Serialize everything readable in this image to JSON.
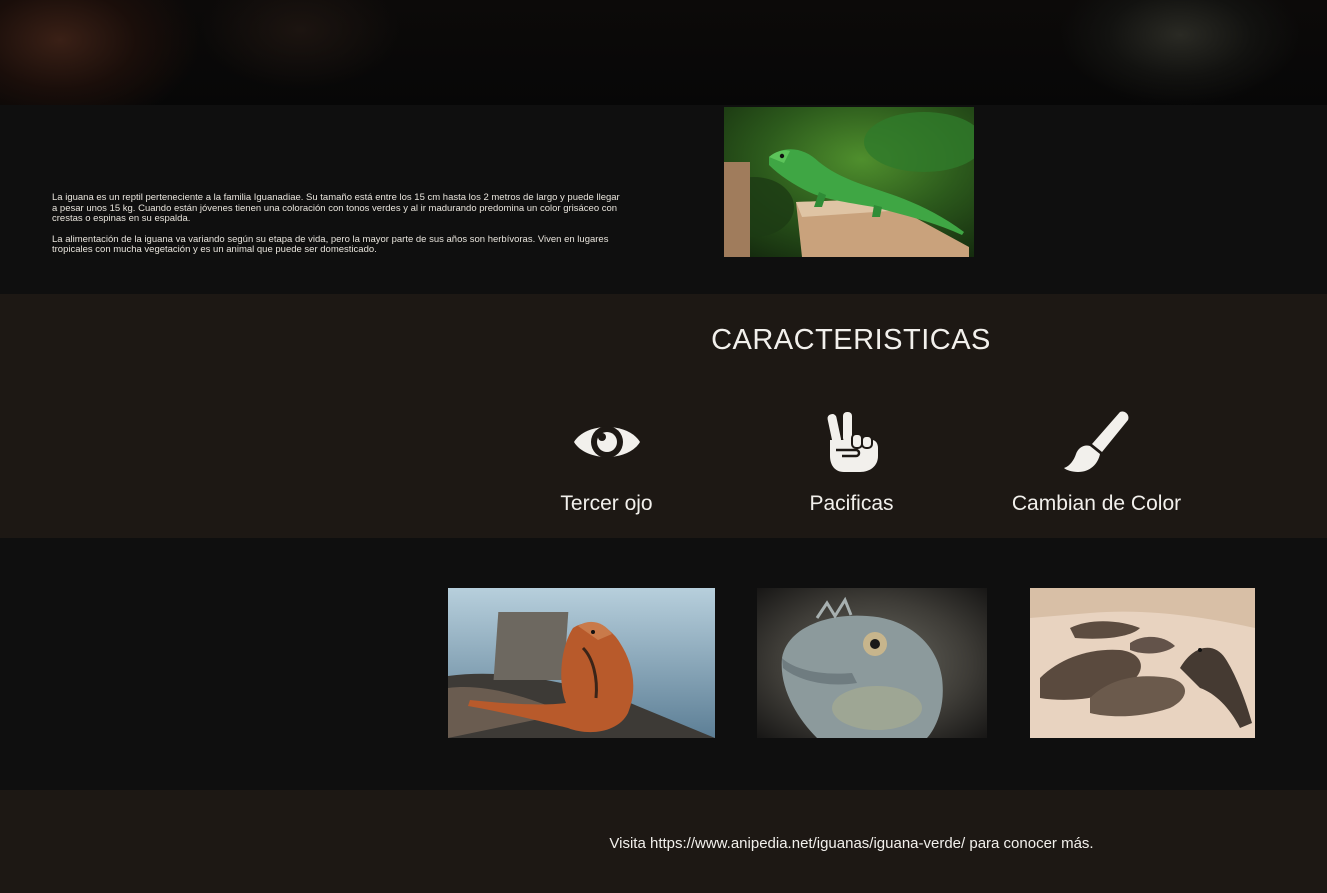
{
  "intro": {
    "paragraph_1": "La iguana es un reptil perteneciente a la familia Iguanadiae. Su tamaño está entre los 15 cm hasta los 2 metros de largo y puede llegar a pesar unos 15 kg. Cuando están jóvenes tienen una coloración con tonos verdes y al ir madurando predomina un color grisáceo con crestas o espinas en su espalda.",
    "paragraph_2": "La alimentación de la iguana va variando según su etapa de vida, pero la mayor parte de sus años son herbívoras. Viven en lugares tropicales con mucha vegetación y es un animal que puede ser domesticado."
  },
  "features": {
    "title": "CARACTERISTICAS",
    "items": [
      {
        "label": "Tercer ojo",
        "icon": "eye-icon"
      },
      {
        "label": "Pacificas",
        "icon": "peace-hand-icon"
      },
      {
        "label": "Cambian de Color",
        "icon": "paintbrush-icon"
      }
    ]
  },
  "footer": {
    "text": "Visita https://www.anipedia.net/iguanas/iguana-verde/ para conocer más."
  },
  "colors": {
    "background": "#0f0f0f",
    "section_alt": "#1d1814",
    "text": "#f2f0ec"
  }
}
